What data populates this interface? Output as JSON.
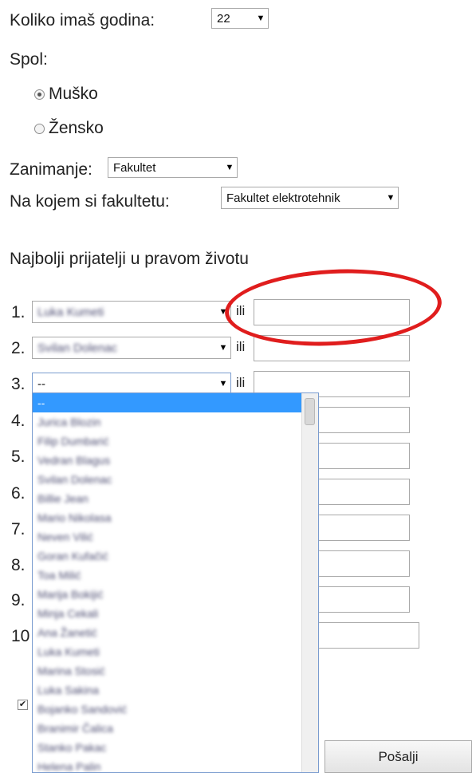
{
  "age": {
    "label": "Koliko imaš godina:",
    "value": "22",
    "arrow": "▼"
  },
  "gender": {
    "label": "Spol:",
    "options": [
      {
        "label": "Muško",
        "checked": true
      },
      {
        "label": "Žensko",
        "checked": false
      }
    ]
  },
  "occupation": {
    "label": "Zanimanje:",
    "value": "Fakultet",
    "arrow": "▼"
  },
  "faculty": {
    "label": "Na kojem si fakultetu:",
    "value": "Fakultet elektrotehnik",
    "arrow": "▼"
  },
  "friends": {
    "heading": "Najbolji prijatelji u pravom životu",
    "or_label": "ili",
    "rows": [
      {
        "num": "1.",
        "value": "Luka Kumeti"
      },
      {
        "num": "2.",
        "value": "Svilan Dolenac"
      },
      {
        "num": "3.",
        "value": "--"
      },
      {
        "num": "4."
      },
      {
        "num": "5."
      },
      {
        "num": "6."
      },
      {
        "num": "7."
      },
      {
        "num": "8."
      },
      {
        "num": "9."
      },
      {
        "num": "10"
      }
    ]
  },
  "dropdown_options": [
    "--",
    "Jurica Blozin",
    "Filip Dumbarić",
    "Vedran Blagus",
    "Svilan Dolenac",
    "Billie Jean",
    "Mario Nikolasa",
    "Neven Vilić",
    "Goran Kufačić",
    "Toa Milić",
    "Marija Bokijić",
    "Minja Cekali",
    "Ana Žanetić",
    "Luka Kumeti",
    "Marina Stosić",
    "Luka Sakina",
    "Bojanko Sandović",
    "Branimir Čalica",
    "Stanko Pakac",
    "Helena Palin"
  ],
  "submit_label": "Pošalji",
  "colors": {
    "highlight": "#3399ff",
    "annotation": "#e01d1d"
  }
}
